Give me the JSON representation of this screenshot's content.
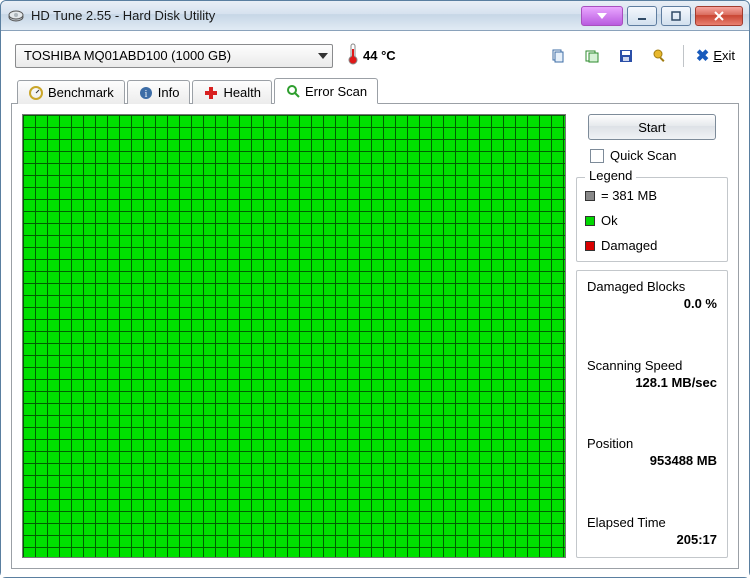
{
  "window": {
    "title": "HD Tune 2.55 - Hard Disk Utility"
  },
  "drive": {
    "selected": "TOSHIBA MQ01ABD100 (1000 GB)"
  },
  "temperature": {
    "value": "44 °C"
  },
  "toolbar": {
    "exit_label": "Exit",
    "copy_icon": "copy-icon",
    "snapshot_icon": "snapshot-icon",
    "save_icon": "save-icon",
    "options_icon": "options-icon"
  },
  "tabs": {
    "benchmark": "Benchmark",
    "info": "Info",
    "health": "Health",
    "error_scan": "Error Scan",
    "active": "error_scan"
  },
  "actions": {
    "start_label": "Start",
    "quick_scan_label": "Quick Scan",
    "quick_scan_checked": false
  },
  "legend": {
    "title": "Legend",
    "block_size": "= 381 MB",
    "ok_label": "Ok",
    "damaged_label": "Damaged"
  },
  "stats": {
    "damaged_blocks": {
      "label": "Damaged Blocks",
      "value": "0.0 %"
    },
    "scanning_speed": {
      "label": "Scanning Speed",
      "value": "128.1 MB/sec"
    },
    "position": {
      "label": "Position",
      "value": "953488 MB"
    },
    "elapsed_time": {
      "label": "Elapsed Time",
      "value": "205:17"
    }
  }
}
